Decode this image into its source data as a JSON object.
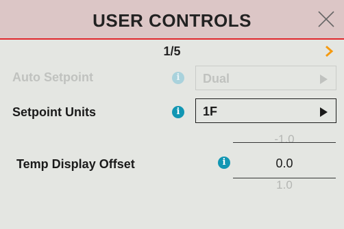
{
  "header": {
    "title": "USER CONTROLS"
  },
  "pager": {
    "indicator": "1/5"
  },
  "rows": {
    "auto_setpoint": {
      "label": "Auto Setpoint",
      "value": "Dual",
      "enabled": false
    },
    "setpoint_units": {
      "label": "Setpoint Units",
      "value": "1F",
      "enabled": true
    },
    "temp_display_offset": {
      "label": "Temp Display Offset",
      "prev_value": "-1.0",
      "value": "0.0",
      "next_value": "1.0"
    }
  },
  "icons": {
    "info": "i"
  },
  "colors": {
    "accent_red": "#e0262b",
    "info_blue": "#1196b3",
    "next_orange": "#f59a10",
    "header_bg": "#dcc6c6"
  }
}
